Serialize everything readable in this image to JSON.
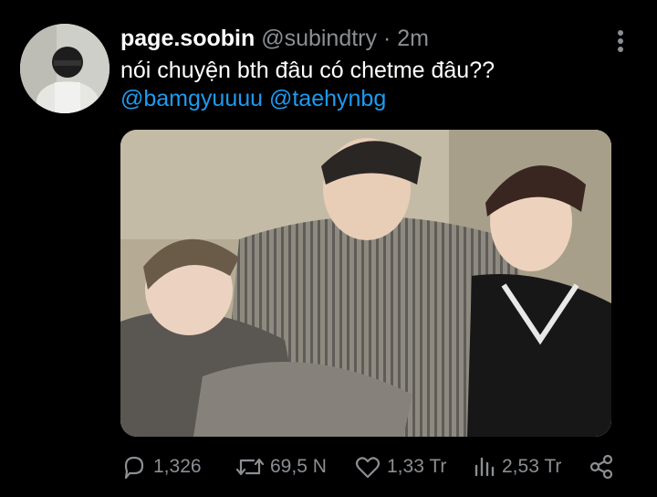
{
  "tweet": {
    "display_name": "page.soobin",
    "handle": "@subindtry",
    "separator": "·",
    "time": "2m",
    "text": "nói chuyện bth đâu có chetme đâu??",
    "mentions": [
      "@bamgyuuuu",
      "@taehynbg"
    ]
  },
  "actions": {
    "replies": "1,326",
    "retweets": "69,5 N",
    "likes": "1,33 Tr",
    "views": "2,53 Tr"
  },
  "icons": [
    "more-vertical-icon",
    "reply-icon",
    "retweet-icon",
    "like-icon",
    "views-icon",
    "share-icon"
  ],
  "colors": {
    "background": "#000000",
    "text": "#ffffff",
    "secondary": "#8b8f93",
    "link": "#1d9bf0"
  }
}
